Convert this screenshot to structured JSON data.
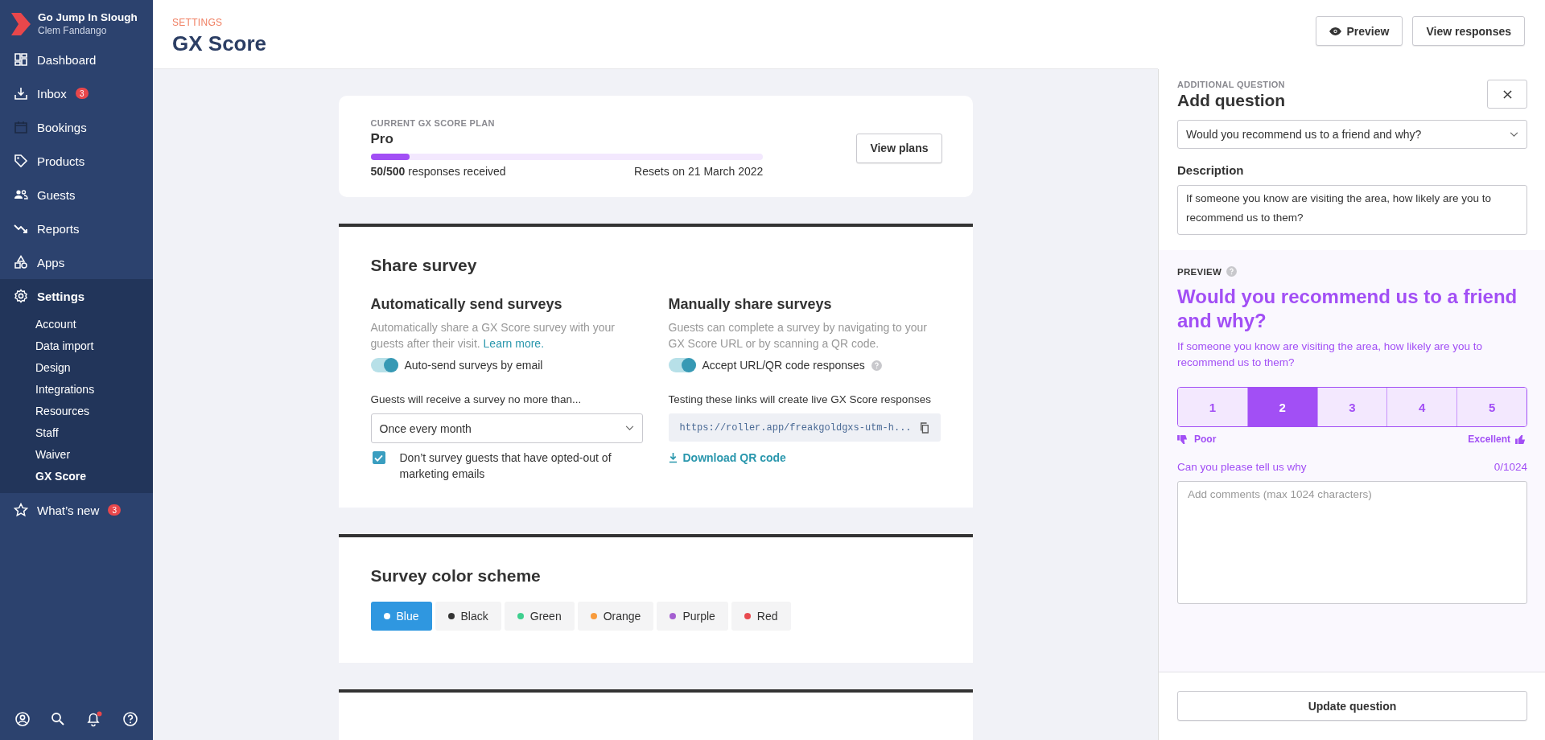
{
  "sidebar": {
    "org": "Go Jump In Slough",
    "user": "Clem Fandango",
    "notification_dot": true,
    "items": [
      {
        "label": "Dashboard",
        "selected": false
      },
      {
        "label": "Inbox",
        "badge": "3",
        "selected": false
      },
      {
        "label": "Bookings",
        "selected": false
      },
      {
        "label": "Products",
        "selected": false
      },
      {
        "label": "Guests",
        "selected": false
      },
      {
        "label": "Reports",
        "selected": false
      },
      {
        "label": "Apps",
        "selected": false
      },
      {
        "label": "Settings",
        "selected": true,
        "expanded": true,
        "children": [
          {
            "label": "Account",
            "selected": false
          },
          {
            "label": "Data import",
            "selected": false
          },
          {
            "label": "Design",
            "selected": false
          },
          {
            "label": "Integrations",
            "selected": false
          },
          {
            "label": "Resources",
            "selected": false
          },
          {
            "label": "Staff",
            "selected": false
          },
          {
            "label": "Waiver",
            "selected": false
          },
          {
            "label": "GX Score",
            "selected": true
          }
        ]
      },
      {
        "label": "What’s new",
        "badge": "3",
        "selected": false
      }
    ]
  },
  "header": {
    "breadcrumb": "SETTINGS",
    "title": "GX Score",
    "buttons": [
      "Preview",
      "View responses"
    ]
  },
  "plan": {
    "caption": "CURRENT GX SCORE PLAN",
    "name": "Pro",
    "level": 0.1,
    "responses": "**50/500** responses received",
    "reset": "Resets on 21 March 2022",
    "button": "View plans"
  },
  "share": {
    "title": "Share survey",
    "auto": {
      "title": "Automatically send surveys",
      "text": "Automatically share a GX Score survey with your guests after their visit.",
      "link": "Learn more.",
      "toggle": {
        "label": "Auto-send surveys by email",
        "on": true
      },
      "frequency_label": "Guests will receive a survey no more than...",
      "frequency": "Once every month",
      "checkbox": {
        "label": "Don’t survey guests that have opted-out of marketing emails",
        "checked": true
      }
    },
    "manual": {
      "title": "Manually share surveys",
      "text": "Guests can complete a survey by navigating to your GX Score URL or by scanning a QR code.",
      "toggle": {
        "label": "Accept URL/QR code responses",
        "on": true
      },
      "links_note": "Testing these links will create live GX Score responses",
      "url": "https://roller.app/freakgoldgxs-utm-h...",
      "download": "Download QR code"
    }
  },
  "color_scheme": {
    "title": "Survey color scheme",
    "options": [
      {
        "label": "Blue",
        "color": "#2f97e0",
        "selected": true
      },
      {
        "label": "Black",
        "color": "#333333",
        "selected": false
      },
      {
        "label": "Green",
        "color": "#3ecf8e",
        "selected": false
      },
      {
        "label": "Orange",
        "color": "#f89b3c",
        "selected": false
      },
      {
        "label": "Purple",
        "color": "#a45fd1",
        "selected": false
      },
      {
        "label": "Red",
        "color": "#e84a4f",
        "selected": false
      }
    ]
  },
  "panel": {
    "caption": "ADDITIONAL QUESTION",
    "title": "Add question",
    "question": "Would you recommend us to a friend and why?",
    "description_label": "Description",
    "description": "If someone you know are visiting the area, how likely are you to recommend us to them?",
    "preview": {
      "label": "PREVIEW",
      "question": "Would you recommend us to a friend and why?",
      "description": "If someone you know are visiting the area, how likely are you to recommend us to them?",
      "ratings": [
        {
          "label": "1",
          "selected": false
        },
        {
          "label": "2",
          "selected": true
        },
        {
          "label": "3",
          "selected": false
        },
        {
          "label": "4",
          "selected": false
        },
        {
          "label": "5",
          "selected": false
        }
      ],
      "low": "Poor",
      "high": "Excellent",
      "comment_label": "Can you please tell us why",
      "counter": "0/1024",
      "comment_placeholder": "Add comments (max 1024 characters)"
    },
    "update_button": "Update question"
  }
}
